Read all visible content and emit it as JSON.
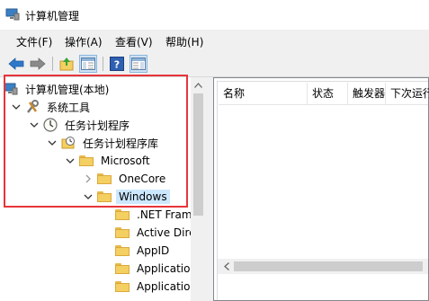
{
  "window": {
    "title": "计算机管理"
  },
  "menu": [
    {
      "label": "文件(F)"
    },
    {
      "label": "操作(A)"
    },
    {
      "label": "查看(V)"
    },
    {
      "label": "帮助(H)"
    }
  ],
  "toolbar": {
    "buttons": [
      "back-icon",
      "forward-icon",
      "up-folder-icon",
      "show-hide-tree-icon",
      "help-icon",
      "properties-icon"
    ]
  },
  "tree": {
    "root": "计算机管理(本地)",
    "system_tools": "系统工具",
    "task_scheduler": "任务计划程序",
    "task_library": "任务计划程序库",
    "microsoft": "Microsoft",
    "onecore": "OneCore",
    "windows": "Windows",
    "children": [
      ".NET Frame",
      "Active Direc",
      "AppID",
      "Application",
      "Application"
    ]
  },
  "list": {
    "columns": [
      "名称",
      "状态",
      "触发器",
      "下次运行"
    ]
  },
  "colors": {
    "highlight": "#e8353b",
    "selection": "#cce8ff",
    "folder": "#f4cf62"
  }
}
